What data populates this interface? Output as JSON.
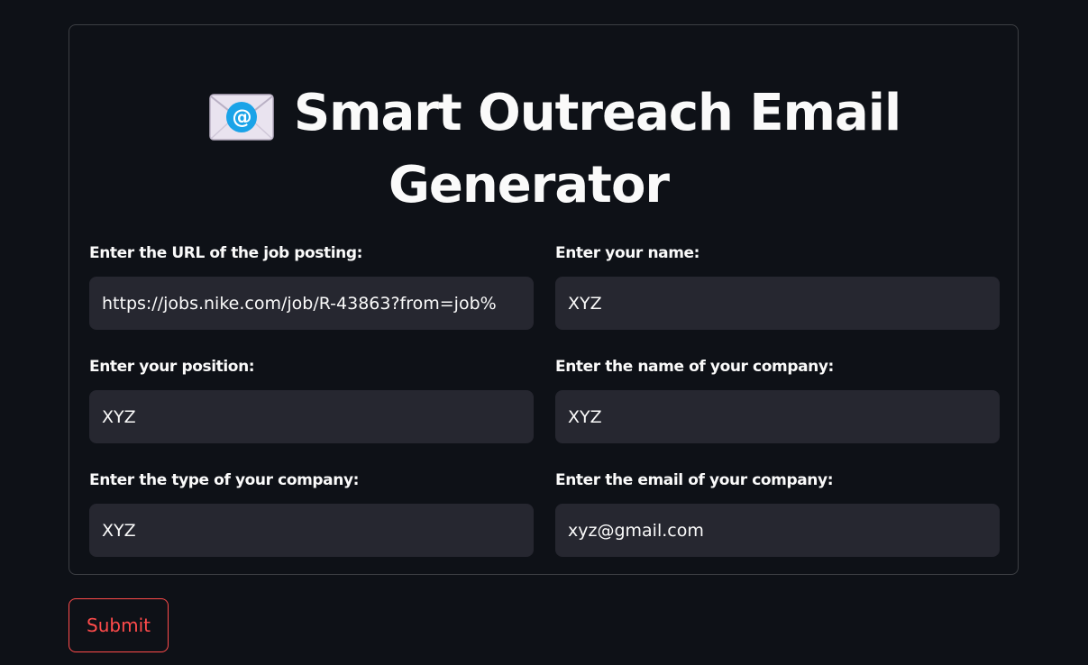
{
  "header": {
    "icon": "email-envelope-icon",
    "title_line1": "Smart Outreach Email",
    "title_line2": "Generator"
  },
  "form": {
    "fields": [
      {
        "label": "Enter the URL of the job posting:",
        "value": "https://jobs.nike.com/job/R-43863?from=job%"
      },
      {
        "label": "Enter your name:",
        "value": "XYZ"
      },
      {
        "label": "Enter your position:",
        "value": "XYZ"
      },
      {
        "label": "Enter the name of your company:",
        "value": "XYZ"
      },
      {
        "label": "Enter the type of your company:",
        "value": "XYZ"
      },
      {
        "label": "Enter the email of your company:",
        "value": "xyz@gmail.com"
      }
    ],
    "submit_label": "Submit"
  },
  "colors": {
    "background": "#0e1117",
    "input_background": "#262730",
    "text": "#fafafa",
    "accent": "#ff4b4b",
    "icon_blue": "#1aa3e8"
  }
}
